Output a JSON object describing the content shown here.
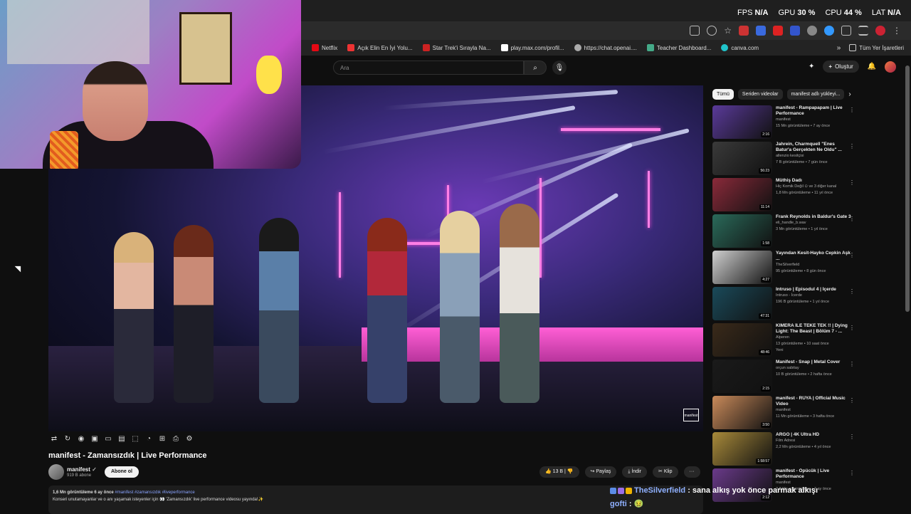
{
  "overlay": {
    "fps_label": "FPS",
    "fps_value": "N/A",
    "gpu_label": "GPU",
    "gpu_value": "30 %",
    "cpu_label": "CPU",
    "cpu_value": "44 %",
    "lat_label": "LAT",
    "lat_value": "N/A"
  },
  "bookmarks": [
    "Netflix",
    "Açık Elin En İyi Yolu...",
    "Star Trek'i Sırayla Na...",
    "play.max.com/profil...",
    "https://chat.openai....",
    "Teacher Dashboard...",
    "canva.com"
  ],
  "bookmarks_more": "»",
  "bookmarks_all": "Tüm Yer İşaretleri",
  "header": {
    "search_placeholder": "Ara",
    "create_label": "Oluştur",
    "create_icon": "+"
  },
  "video": {
    "title": "manifest - Zamansızdık | Live Performance",
    "channel": "manifest",
    "subscribers": "919 B abone",
    "subscribe_label": "Abone ol",
    "likes": "13 B",
    "share_label": "Paylaş",
    "download_label": "İndir",
    "clip_label": "Klip",
    "more_label": "···",
    "watermark": "manifest",
    "desc_stats": "1,6 Mn görüntüleme  6 ay önce",
    "desc_tags": "#manifest #zamansızdık #liveperformance",
    "desc_text": "Konseri unutamayanlar ve o anı yaşamak isteyenler için 👀 'Zamansızdık' live performance videosu yayında!✨"
  },
  "chips": [
    "Tümü",
    "Seriden videolar",
    "manifest adlı yükleyi..."
  ],
  "recommendations": [
    {
      "title": "manifest - Rampapapam | Live Performance",
      "channel": "manifest",
      "meta": "15 Mn görüntüleme • 7 ay önce",
      "duration": "2:16",
      "color": "#5a3a9a"
    },
    {
      "title": "Jahrein, Charmquell \"Enes Batur'a Gerçekten Ne Oldu\" ...",
      "channel": "allenzio kesitçisi",
      "meta": "7 B görüntüleme • 7 gün önce",
      "duration": "56:23",
      "color": "#3a3a3a"
    },
    {
      "title": "Müthiş Dadı",
      "channel": "Hiç Komik Değil ⊙ ve 3 diğer kanal",
      "meta": "1,8 Mn görüntüleme • 11 yıl önce",
      "duration": "11:14",
      "color": "#8a2a3a"
    },
    {
      "title": "Frank Reynolds in Baldur's Gate 3",
      "channel": "eli_handle_b.wav",
      "meta": "3 Mn görüntüleme • 1 yıl önce",
      "duration": "1:58",
      "color": "#2a6a5a"
    },
    {
      "title": "Yayından Kesit-Hayko Cepkin Aşk ...",
      "channel": "TheSilverfield",
      "meta": "95 görüntüleme • 8 gün önce",
      "duration": "4:27",
      "color": "#d0d0d0"
    },
    {
      "title": "Intruso | Episodul 4 | İçerde",
      "channel": "Intruso - İcerde",
      "meta": "196 B görüntüleme • 1 yıl önce",
      "duration": "47:31",
      "color": "#1a4a5a"
    },
    {
      "title": "KIMERA İLE TEKE TEK !! | Dying Light: The Beast | Bölüm 7 - ...",
      "channel": "Alperen",
      "meta": "13 görüntüleme • 10 saat önce",
      "duration": "48:46",
      "color": "#3a2a1a",
      "badge": "Yeni"
    },
    {
      "title": "Manifest - Snap | Metal Cover",
      "channel": "orçun sabitay",
      "meta": "10 B görüntüleme • 2 hafta önce",
      "duration": "2:15",
      "color": "#1a1a1a"
    },
    {
      "title": "manifest - RÜYA | Official Music Video",
      "channel": "manifest",
      "meta": "11 Mn görüntüleme • 3 hafta önce",
      "duration": "3:50",
      "color": "#c98a5a"
    },
    {
      "title": "ARGO | 4K Ultra HD",
      "channel": "Film Adresi",
      "meta": "2,2 Mn görüntüleme • 4 yıl önce",
      "duration": "1:58:57",
      "color": "#a88a3a"
    },
    {
      "title": "manifest - Öpücük | Live Performance",
      "channel": "manifest",
      "meta": "2,8 Mn görüntüleme • 7 ay önce",
      "duration": "2:12",
      "color": "#6a3a8a"
    }
  ],
  "chat": [
    {
      "user": "TheSilverfield",
      "message": ": sana alkış yok önce parmak alkışı"
    },
    {
      "user": "gofti",
      "message": ": 🤢"
    }
  ]
}
